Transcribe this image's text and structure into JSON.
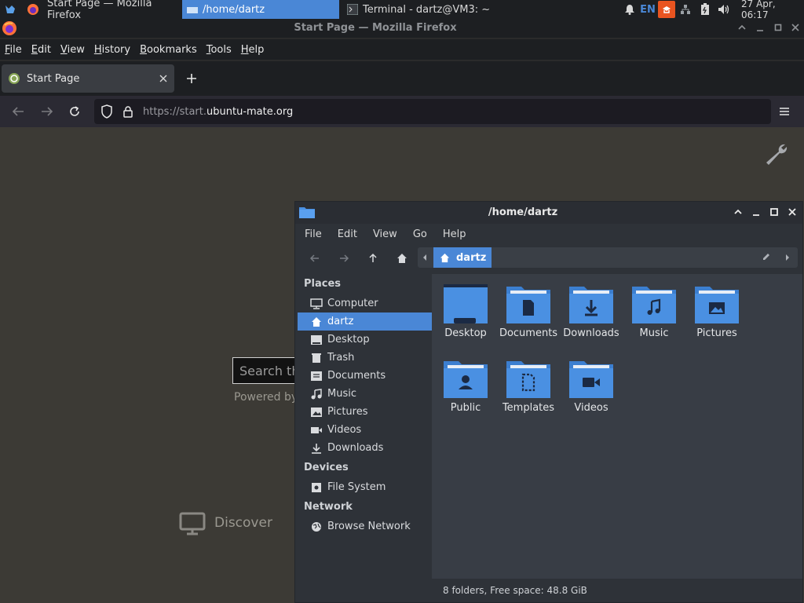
{
  "panel": {
    "tasks": [
      {
        "label": "Start Page — Mozilla Firefox"
      },
      {
        "label": "/home/dartz"
      },
      {
        "label": "Terminal - dartz@VM3: ~"
      }
    ],
    "keyboard_layout": "EN",
    "clock": "27 Apr, 06:17",
    "accent": "#4a87d6"
  },
  "firefox": {
    "window_title": "Start Page — Mozilla Firefox",
    "menu": [
      {
        "mnemonic": "F",
        "rest": "ile"
      },
      {
        "mnemonic": "E",
        "rest": "dit"
      },
      {
        "mnemonic": "V",
        "rest": "iew"
      },
      {
        "mnemonic": "H",
        "rest": "istory"
      },
      {
        "mnemonic": "B",
        "rest": "ookmarks"
      },
      {
        "mnemonic": "T",
        "rest": "ools"
      },
      {
        "mnemonic": "H",
        "rest": "elp"
      }
    ],
    "tab_title": "Start Page",
    "url_prefix": "https://start.",
    "url_domain": "ubuntu-mate.org",
    "page": {
      "search_placeholder": "Search th",
      "powered_by": "Powered by",
      "discover": "Discover"
    }
  },
  "caja": {
    "window_title": "/home/dartz",
    "menu": [
      "File",
      "Edit",
      "View",
      "Go",
      "Help"
    ],
    "path_segment": "dartz",
    "sidebar": {
      "places_heading": "Places",
      "places": [
        "Computer",
        "dartz",
        "Desktop",
        "Trash",
        "Documents",
        "Music",
        "Pictures",
        "Videos",
        "Downloads"
      ],
      "devices_heading": "Devices",
      "devices": [
        "File System"
      ],
      "network_heading": "Network",
      "network": [
        "Browse Network"
      ]
    },
    "folders": [
      "Desktop",
      "Documents",
      "Downloads",
      "Music",
      "Pictures",
      "Public",
      "Templates",
      "Videos"
    ],
    "status": "8 folders, Free space: 48.8 GiB",
    "folder_color": "#4a90e2"
  }
}
